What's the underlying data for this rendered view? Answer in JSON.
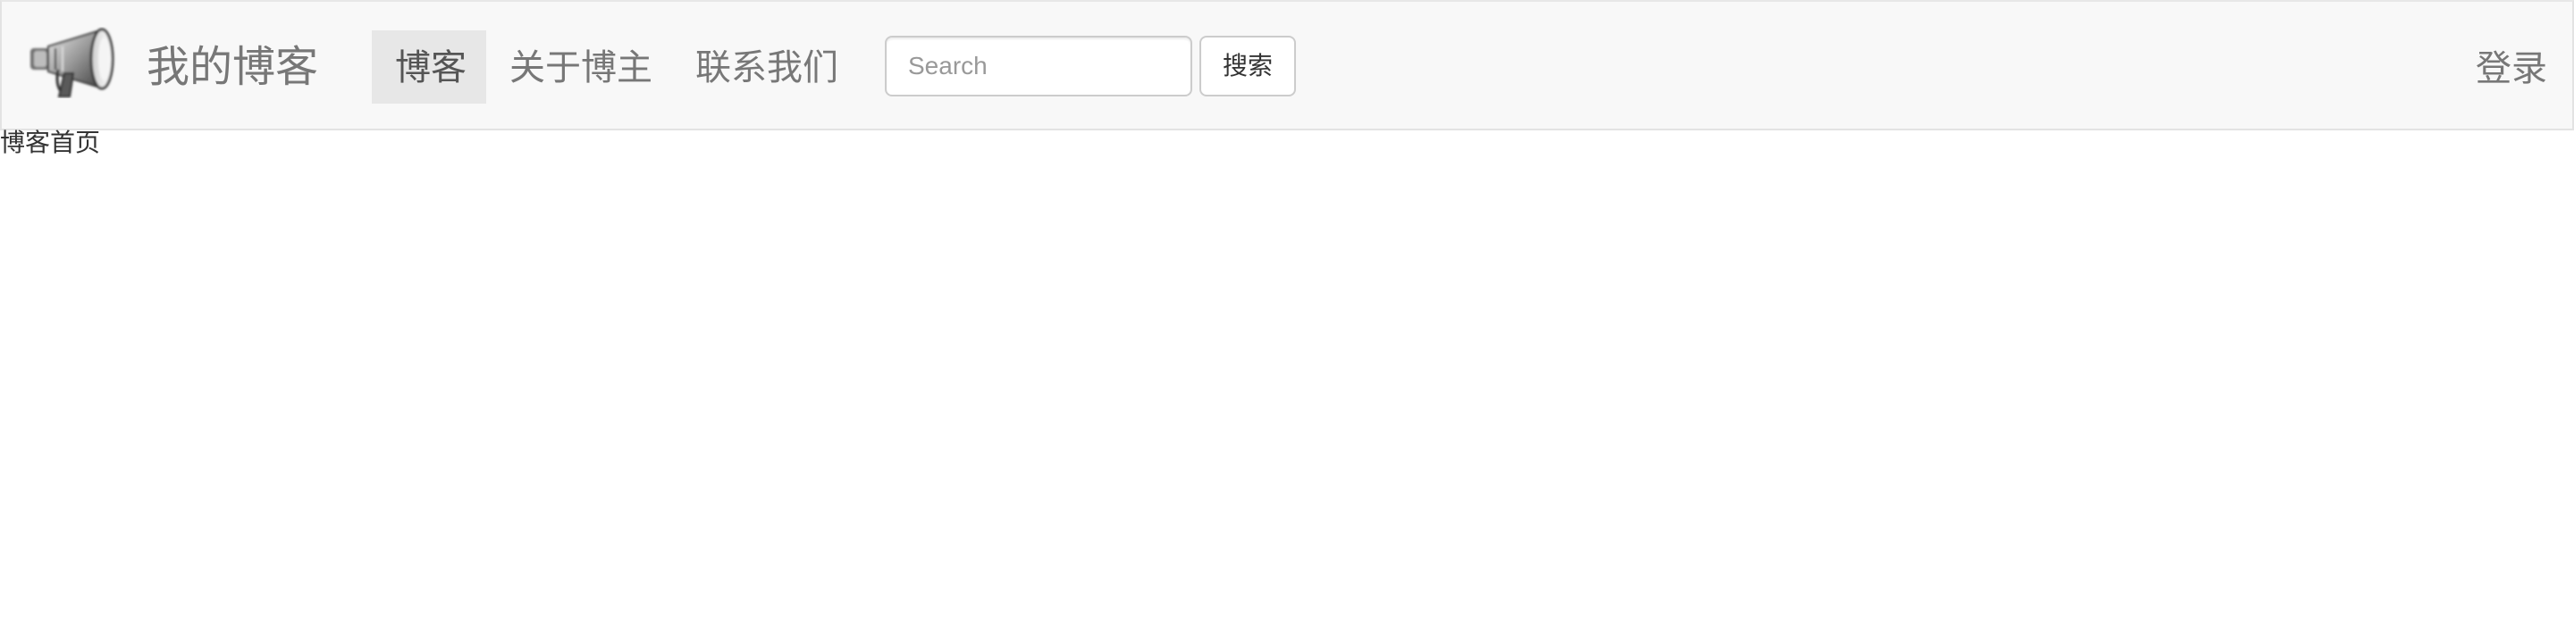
{
  "navbar": {
    "logo_icon": "megaphone-icon",
    "brand": "我的博客",
    "links": [
      {
        "label": "博客",
        "active": true
      },
      {
        "label": "关于博主",
        "active": false
      },
      {
        "label": "联系我们",
        "active": false
      }
    ],
    "search": {
      "placeholder": "Search",
      "value": "",
      "button_label": "搜索"
    },
    "login_label": "登录"
  },
  "main": {
    "text": "博客首页"
  },
  "colors": {
    "navbar_bg": "#f8f8f8",
    "navbar_border": "#e7e7e7",
    "active_tab_bg": "#e7e7e7",
    "nav_text": "#777777"
  }
}
